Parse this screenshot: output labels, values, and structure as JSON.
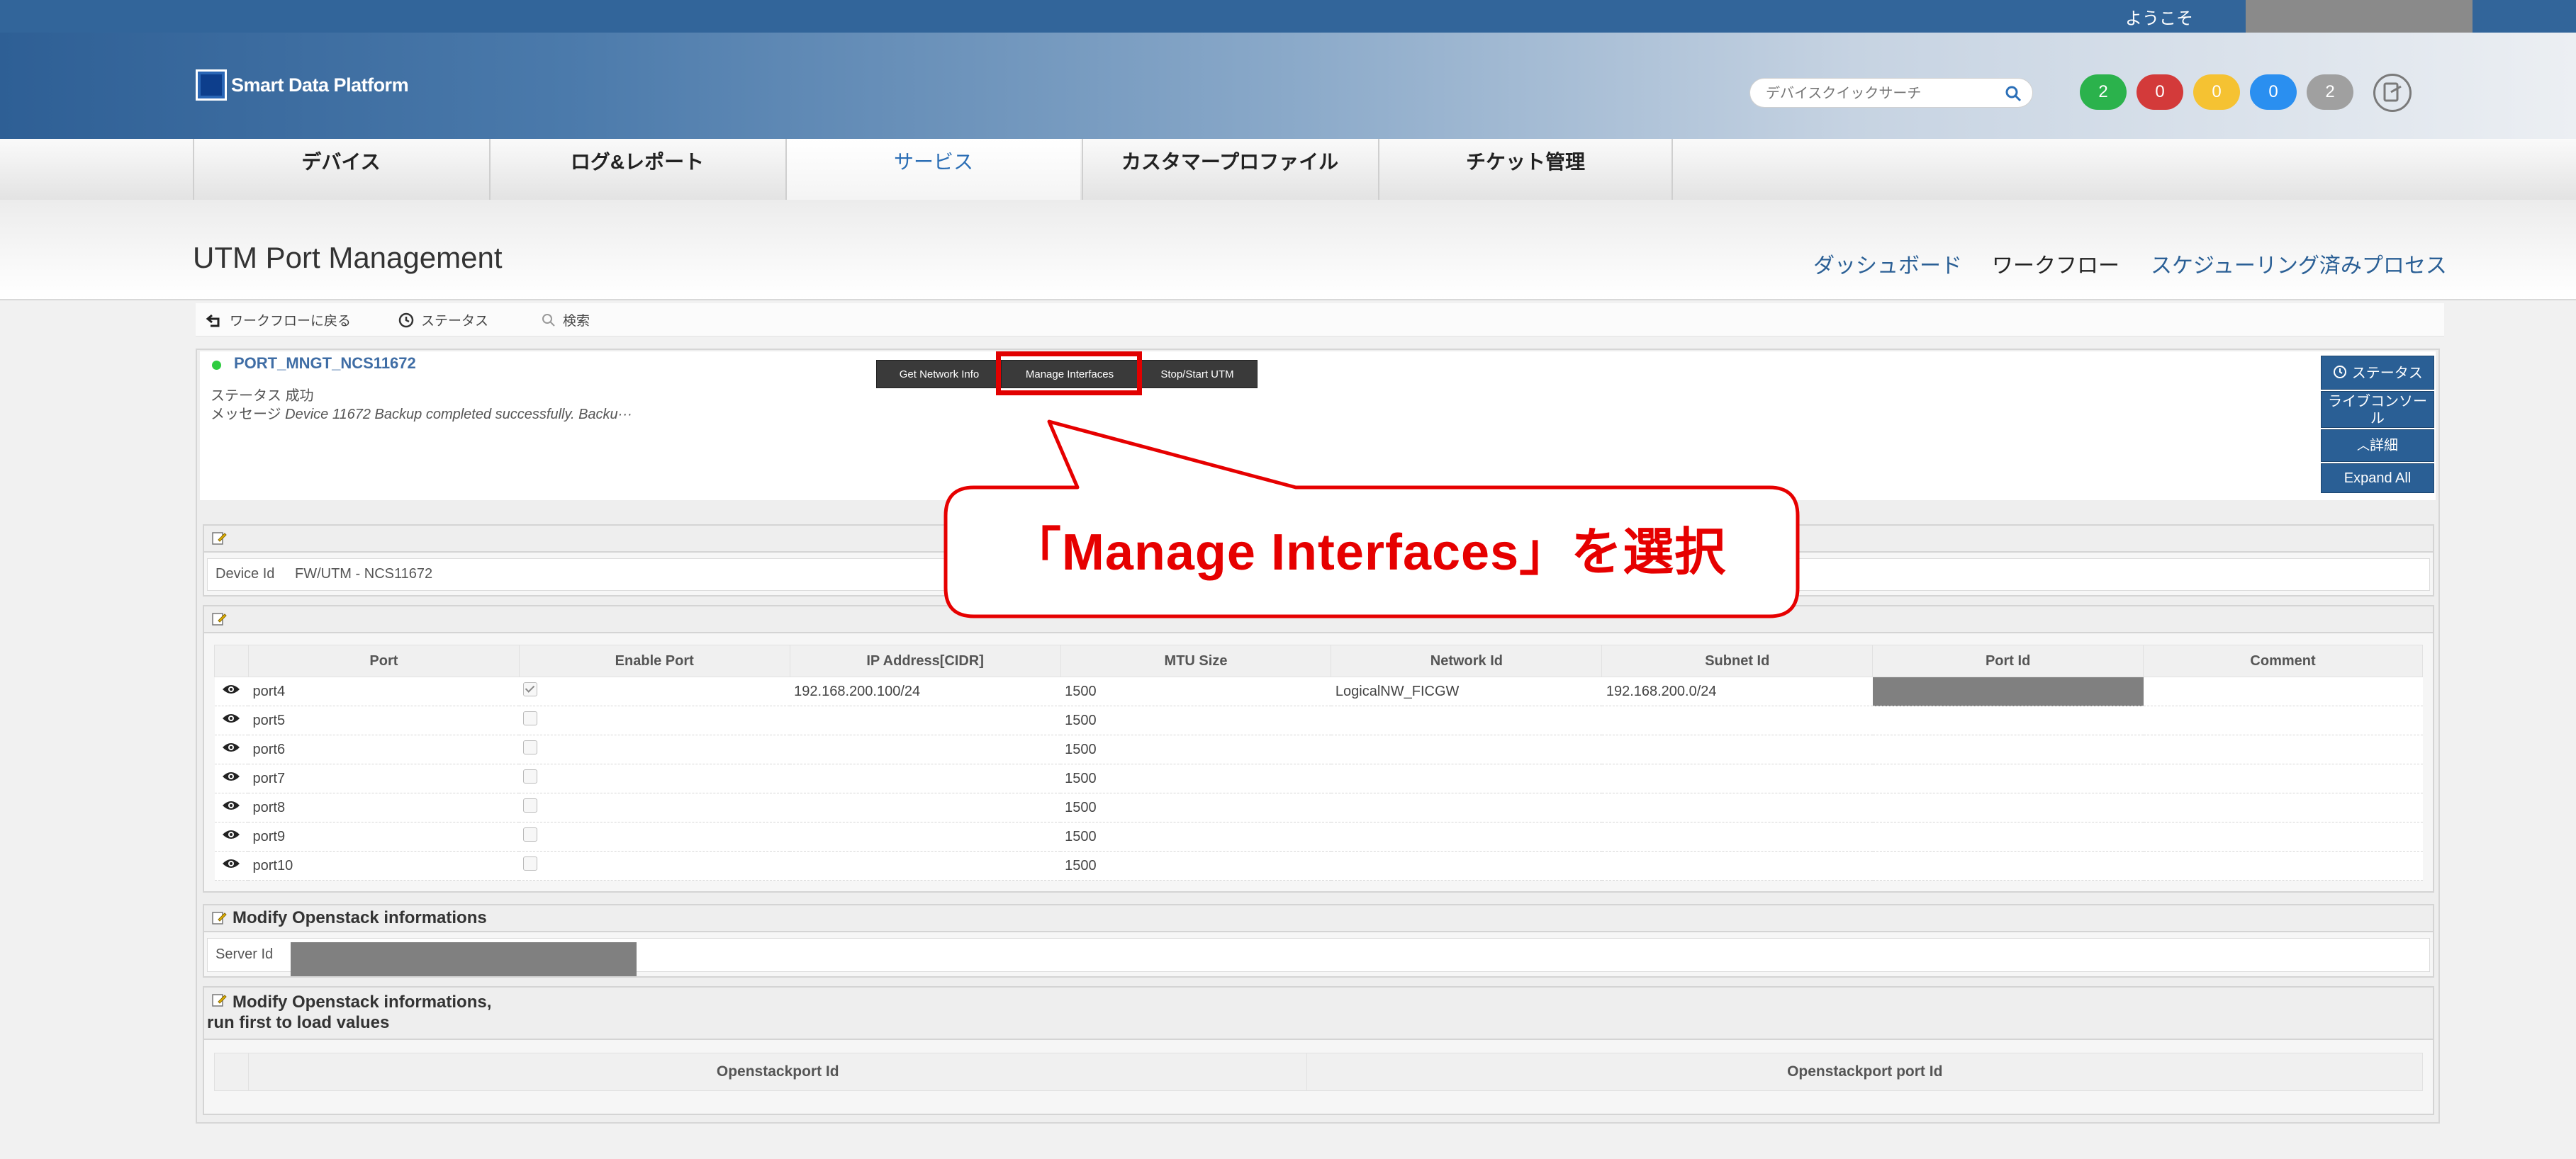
{
  "header": {
    "welcome": "ようこそ",
    "logo_text": "Smart Data Platform",
    "search_placeholder": "デバイスクイックサーチ",
    "badges": [
      {
        "value": "2",
        "color": "#2bb24c"
      },
      {
        "value": "0",
        "color": "#d33a3a"
      },
      {
        "value": "0",
        "color": "#f5c232"
      },
      {
        "value": "0",
        "color": "#2a8ff0"
      },
      {
        "value": "2",
        "color": "#a0a0a0"
      }
    ]
  },
  "nav": {
    "tabs": [
      "デバイス",
      "ログ&レポート",
      "サービス",
      "カスタマープロファイル",
      "チケット管理"
    ],
    "active": "サービス"
  },
  "page": {
    "title": "UTM Port Management",
    "right_links": [
      "ダッシュボード",
      "ワークフロー",
      "スケジューリング済みプロセス"
    ]
  },
  "toolbar": {
    "back": "ワークフローに戻る",
    "status": "ステータス",
    "search": "検索"
  },
  "job": {
    "name": "PORT_MNGT_NCS11672",
    "status_label": "ステータス",
    "status_value": "成功",
    "message_label": "メッセージ",
    "message_value": "Device 11672 Backup completed successfully. Backu···"
  },
  "actions": [
    "Get Network Info",
    "Manage Interfaces",
    "Stop/Start UTM"
  ],
  "side_buttons": {
    "status": "ステータス",
    "live_console": "ライブコンソール",
    "details": "詳細",
    "expand_all": "Expand All"
  },
  "callout": "「Manage Interfaces」を選択",
  "device": {
    "label": "Device Id",
    "value": "FW/UTM - NCS11672"
  },
  "port_table": {
    "headers": [
      "Port",
      "Enable Port",
      "IP Address[CIDR]",
      "MTU Size",
      "Network Id",
      "Subnet Id",
      "Port Id",
      "Comment"
    ],
    "rows": [
      {
        "port": "port4",
        "enabled": true,
        "ip": "192.168.200.100/24",
        "mtu": "1500",
        "network": "LogicalNW_FICGW",
        "subnet": "192.168.200.0/24"
      },
      {
        "port": "port5",
        "enabled": false,
        "ip": "",
        "mtu": "1500",
        "network": "",
        "subnet": ""
      },
      {
        "port": "port6",
        "enabled": false,
        "ip": "",
        "mtu": "1500",
        "network": "",
        "subnet": ""
      },
      {
        "port": "port7",
        "enabled": false,
        "ip": "",
        "mtu": "1500",
        "network": "",
        "subnet": ""
      },
      {
        "port": "port8",
        "enabled": false,
        "ip": "",
        "mtu": "1500",
        "network": "",
        "subnet": ""
      },
      {
        "port": "port9",
        "enabled": false,
        "ip": "",
        "mtu": "1500",
        "network": "",
        "subnet": ""
      },
      {
        "port": "port10",
        "enabled": false,
        "ip": "",
        "mtu": "1500",
        "network": "",
        "subnet": ""
      }
    ]
  },
  "openstack": {
    "title": "Modify Openstack informations",
    "server_label": "Server Id",
    "title2_line1": "Modify Openstack informations,",
    "title2_line2": "run first to load values",
    "headers": [
      "Openstackport Id",
      "Openstackport port Id"
    ]
  }
}
